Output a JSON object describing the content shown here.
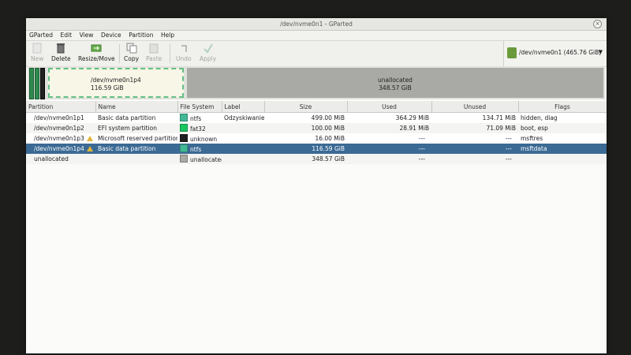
{
  "window": {
    "title": "/dev/nvme0n1 - GParted"
  },
  "menu": [
    "GParted",
    "Edit",
    "View",
    "Device",
    "Partition",
    "Help"
  ],
  "toolbar": {
    "new": "New",
    "delete": "Delete",
    "resize": "Resize/Move",
    "copy": "Copy",
    "paste": "Paste",
    "undo": "Undo",
    "apply": "Apply"
  },
  "device": {
    "name": "/dev/nvme0n1",
    "size": "(465.76 GiB)"
  },
  "diskmap": {
    "partition_name": "/dev/nvme0n1p4",
    "partition_size": "116.59 GiB",
    "unallocated_name": "unallocated",
    "unallocated_size": "348.57 GiB"
  },
  "columns": [
    "Partition",
    "Name",
    "File System",
    "Label",
    "Size",
    "Used",
    "Unused",
    "Flags"
  ],
  "rows": [
    {
      "partition": "/dev/nvme0n1p1",
      "name": "Basic data partition",
      "fs": "ntfs",
      "label": "Odzyskiwanie",
      "size": "499.00 MiB",
      "used": "364.29 MiB",
      "unused": "134.71 MiB",
      "flags": "hidden, diag"
    },
    {
      "partition": "/dev/nvme0n1p2",
      "name": "EFI system partition",
      "fs": "fat32",
      "label": "",
      "size": "100.00 MiB",
      "used": "28.91 MiB",
      "unused": "71.09 MiB",
      "flags": "boot, esp"
    },
    {
      "partition": "/dev/nvme0n1p3",
      "name": "Microsoft reserved partition",
      "fs": "unknown",
      "label": "",
      "size": "16.00 MiB",
      "used": "---",
      "unused": "---",
      "flags": "msftres"
    },
    {
      "partition": "/dev/nvme0n1p4",
      "name": "Basic data partition",
      "fs": "ntfs",
      "label": "",
      "size": "116.59 GiB",
      "used": "---",
      "unused": "---",
      "flags": "msftdata"
    },
    {
      "partition": "unallocated",
      "name": "",
      "fs": "unallocated",
      "label": "",
      "size": "348.57 GiB",
      "used": "---",
      "unused": "---",
      "flags": ""
    }
  ],
  "colors": {
    "ntfs": "#42b894",
    "fat32": "#18c55f",
    "unknown": "#1f1f1f",
    "unallocated": "#a9a9a6",
    "selected": "#3b6a94"
  }
}
